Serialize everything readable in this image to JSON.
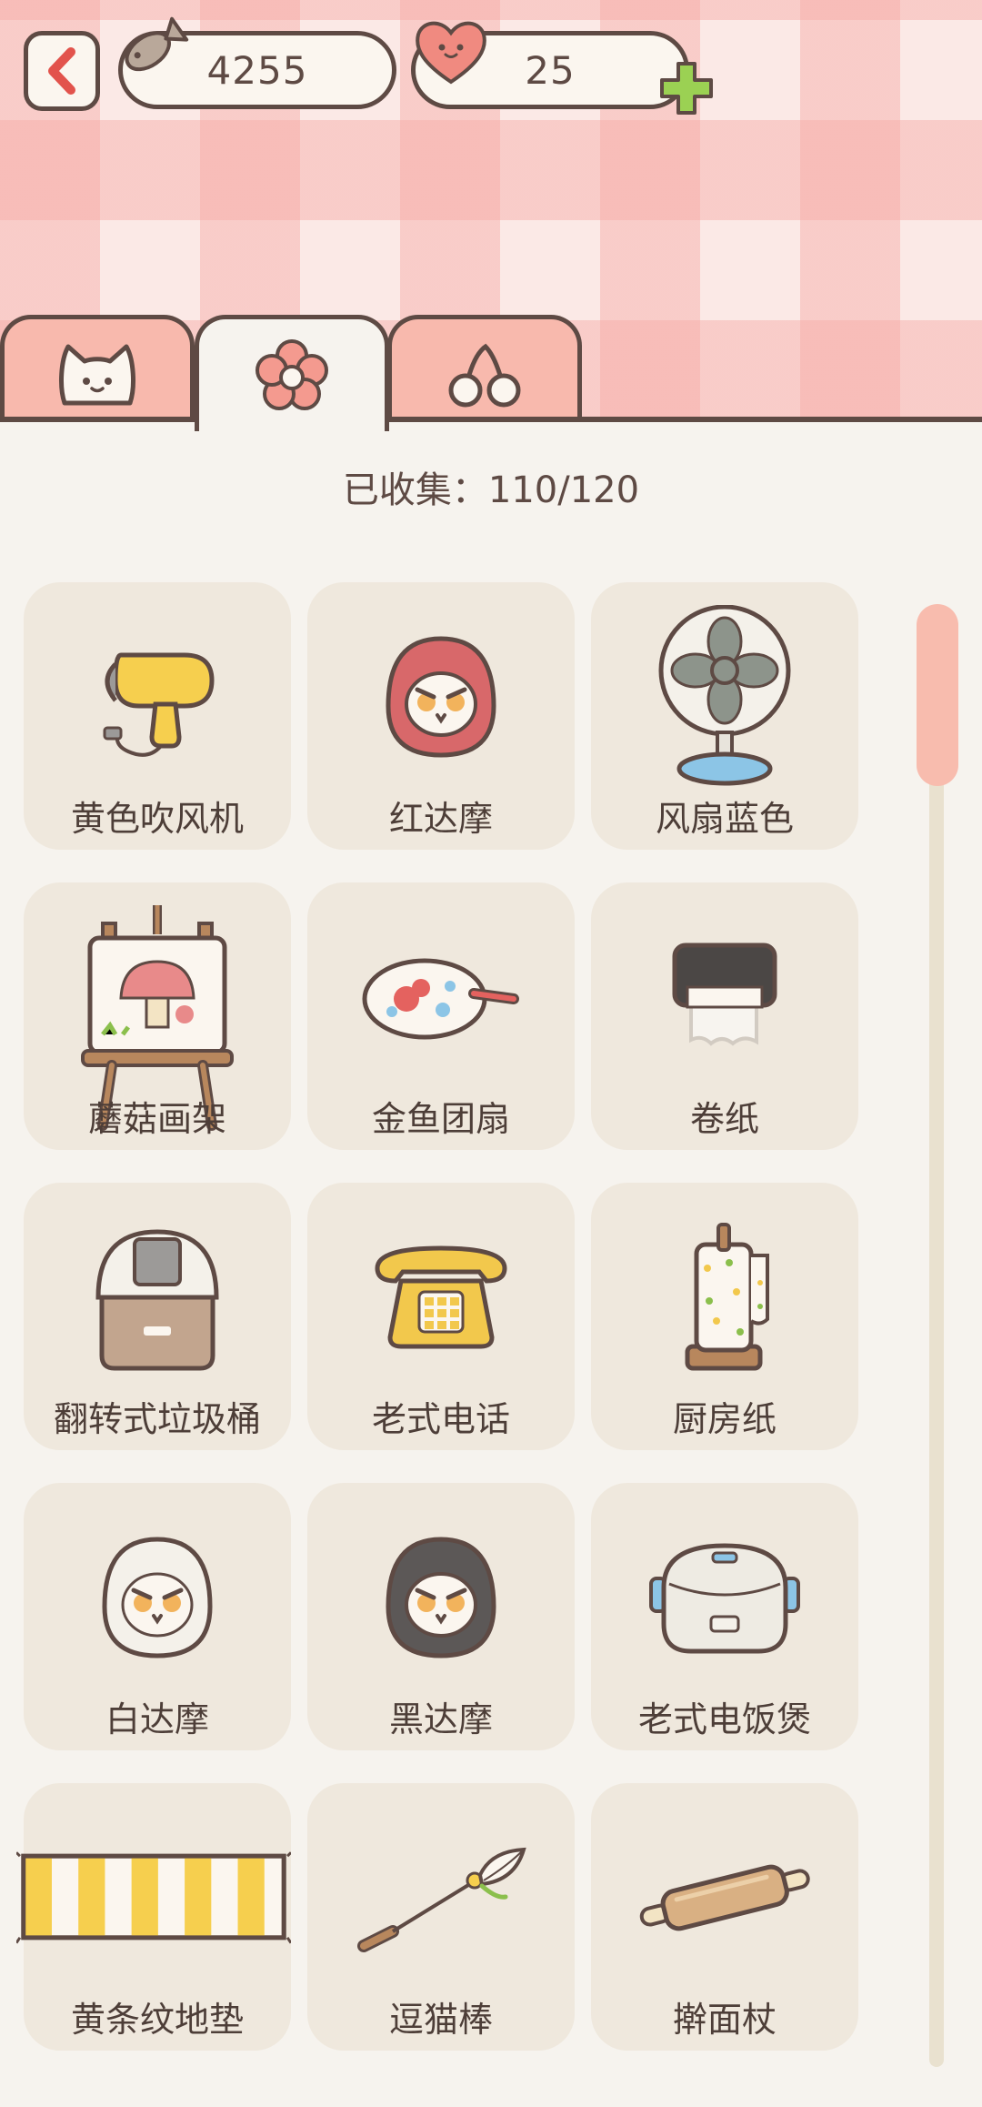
{
  "header": {
    "back_label": "back",
    "coins": "4255",
    "hearts": "25"
  },
  "tabs": [
    {
      "icon": "cat-icon",
      "active": false
    },
    {
      "icon": "flower-icon",
      "active": true
    },
    {
      "icon": "cherry-icon",
      "active": false
    }
  ],
  "collected_text": "已收集：110/120",
  "items": [
    {
      "name": "黄色吹风机",
      "icon": "hair-dryer-icon"
    },
    {
      "name": "红达摩",
      "icon": "red-daruma-icon"
    },
    {
      "name": "风扇蓝色",
      "icon": "blue-fan-icon"
    },
    {
      "name": "蘑菇画架",
      "icon": "mushroom-easel-icon"
    },
    {
      "name": "金鱼团扇",
      "icon": "goldfish-fan-icon"
    },
    {
      "name": "卷纸",
      "icon": "toilet-paper-icon"
    },
    {
      "name": "翻转式垃圾桶",
      "icon": "trash-bin-icon"
    },
    {
      "name": "老式电话",
      "icon": "old-phone-icon"
    },
    {
      "name": "厨房纸",
      "icon": "kitchen-paper-icon"
    },
    {
      "name": "白达摩",
      "icon": "white-daruma-icon"
    },
    {
      "name": "黑达摩",
      "icon": "black-daruma-icon"
    },
    {
      "name": "老式电饭煲",
      "icon": "rice-cooker-icon"
    },
    {
      "name": "黄条纹地垫",
      "icon": "striped-mat-icon"
    },
    {
      "name": "逗猫棒",
      "icon": "cat-teaser-icon"
    },
    {
      "name": "擀面杖",
      "icon": "rolling-pin-icon"
    }
  ],
  "colors": {
    "outline": "#5e4a44",
    "accent_pink": "#f8b9ad",
    "card_bg": "#efe8dd",
    "page_bg": "#f6f3ee"
  }
}
